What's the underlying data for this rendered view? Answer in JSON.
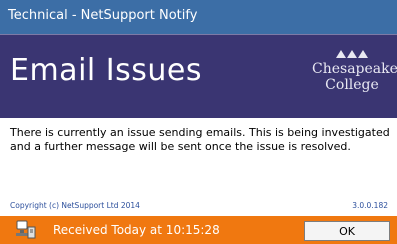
{
  "window": {
    "title": "Technical - NetSupport Notify"
  },
  "header": {
    "heading": "Email Issues",
    "logo": {
      "line1": "Chesapeake",
      "line2": "College",
      "icon": "chesapeake-college-logo"
    }
  },
  "body": {
    "message": "There is currently an issue sending emails. This is being investigated and a further message will be sent once the issue is resolved."
  },
  "meta": {
    "copyright": "Copyright (c) NetSupport Ltd 2014",
    "version": "3.0.0.182"
  },
  "footer": {
    "received": "Received Today at 10:15:28",
    "device_icon": "computer-icon",
    "ok_label": "OK"
  },
  "colors": {
    "titlebar": "#3c6ea6",
    "header": "#3a3572",
    "footer": "#f07810",
    "link_text": "#2c4f9c"
  }
}
